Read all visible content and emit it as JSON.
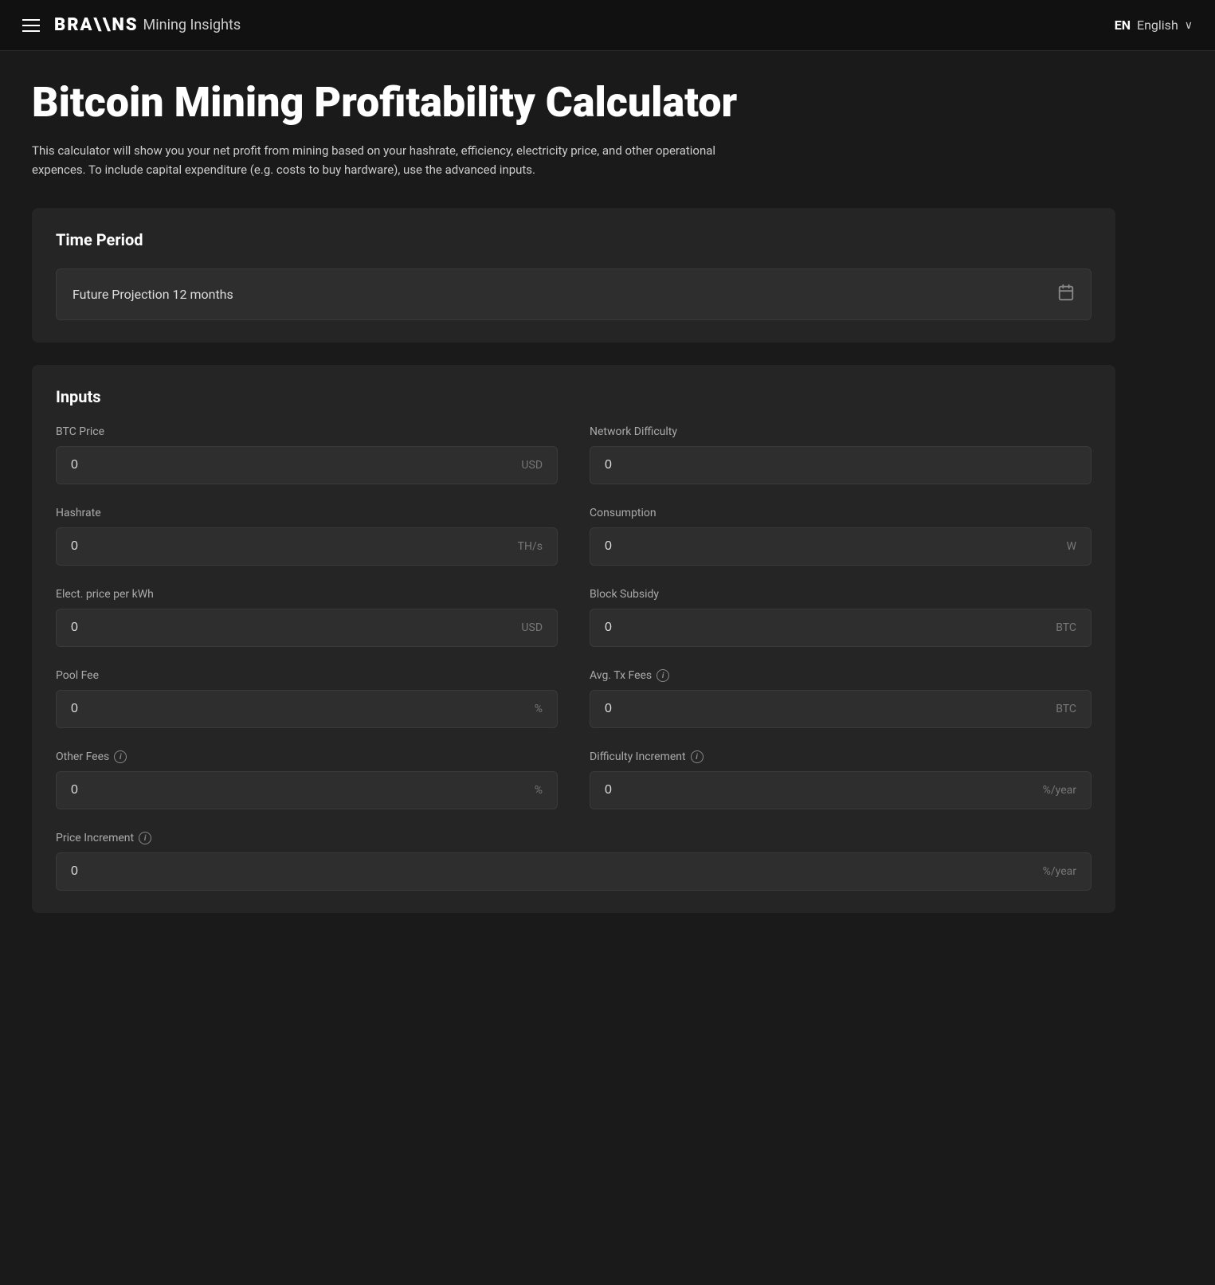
{
  "navbar": {
    "logo_text": "BRA\\NS",
    "logo_subtitle": "Mining Insights",
    "lang_code": "EN",
    "lang_label": "English"
  },
  "page": {
    "title": "Bitcoin Mining Profitability Calculator",
    "description": "This calculator will show you your net profit from mining based on your hashrate, efficiency, electricity price, and other operational expences. To include capital expenditure (e.g. costs to buy hardware), use the advanced inputs."
  },
  "time_period": {
    "section_title": "Time Period",
    "selected_value": "Future Projection 12 months",
    "calendar_icon": "📅"
  },
  "inputs": {
    "section_title": "Inputs",
    "fields": [
      {
        "id": "btc_price",
        "label": "BTC Price",
        "value": "0",
        "unit": "USD",
        "has_info": false
      },
      {
        "id": "network_difficulty",
        "label": "Network Difficulty",
        "value": "0",
        "unit": "",
        "has_info": false
      },
      {
        "id": "hashrate",
        "label": "Hashrate",
        "value": "0",
        "unit": "TH/s",
        "has_info": false
      },
      {
        "id": "consumption",
        "label": "Consumption",
        "value": "0",
        "unit": "W",
        "has_info": false
      },
      {
        "id": "elect_price",
        "label": "Elect. price per kWh",
        "value": "0",
        "unit": "USD",
        "has_info": false
      },
      {
        "id": "block_subsidy",
        "label": "Block Subsidy",
        "value": "0",
        "unit": "BTC",
        "has_info": false
      },
      {
        "id": "pool_fee",
        "label": "Pool Fee",
        "value": "0",
        "unit": "%",
        "has_info": false
      },
      {
        "id": "avg_tx_fees",
        "label": "Avg. Tx Fees",
        "value": "0",
        "unit": "BTC",
        "has_info": true
      },
      {
        "id": "other_fees",
        "label": "Other Fees",
        "value": "0",
        "unit": "%",
        "has_info": true
      },
      {
        "id": "difficulty_increment",
        "label": "Difficulty Increment",
        "value": "0",
        "unit": "%/year",
        "has_info": true
      },
      {
        "id": "price_increment",
        "label": "Price Increment",
        "value": "0",
        "unit": "%/year",
        "has_info": true,
        "full_width": true
      }
    ]
  }
}
